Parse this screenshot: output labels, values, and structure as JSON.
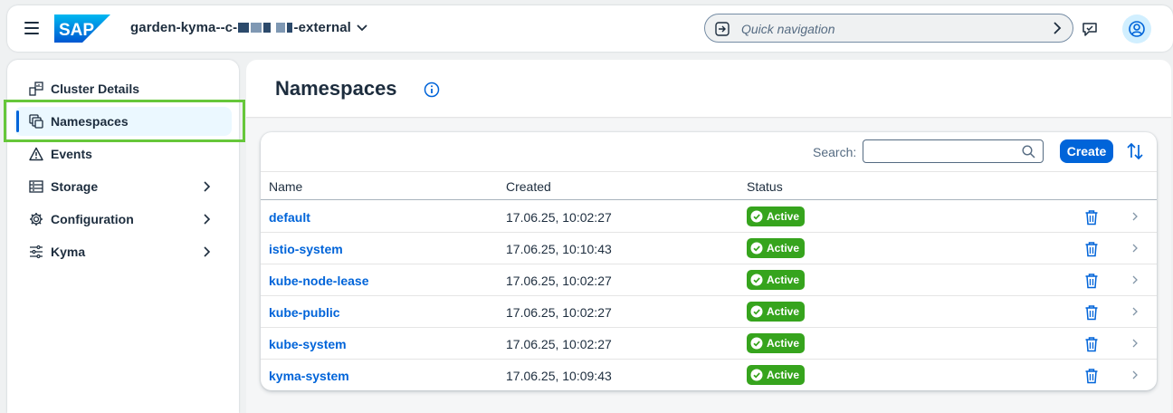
{
  "shell": {
    "cluster_name_prefix": "garden-kyma--c-",
    "cluster_name_suffix": "-external",
    "quick_nav_placeholder": "Quick navigation"
  },
  "sidebar": {
    "items": [
      {
        "label": "Cluster Details",
        "icon": "cluster-details-icon"
      },
      {
        "label": "Namespaces",
        "icon": "namespaces-icon",
        "selected": true
      },
      {
        "label": "Events",
        "icon": "warning-icon"
      },
      {
        "label": "Storage",
        "icon": "storage-icon",
        "expandable": true
      },
      {
        "label": "Configuration",
        "icon": "gear-icon",
        "expandable": true
      },
      {
        "label": "Kyma",
        "icon": "kyma-icon",
        "expandable": true
      }
    ]
  },
  "page": {
    "title": "Namespaces"
  },
  "toolbar": {
    "search_label": "Search:",
    "search_value": "",
    "create_label": "Create"
  },
  "table": {
    "columns": [
      "Name",
      "Created",
      "Status"
    ],
    "rows": [
      {
        "name": "default",
        "created": "17.06.25, 10:02:27",
        "status": "Active"
      },
      {
        "name": "istio-system",
        "created": "17.06.25, 10:10:43",
        "status": "Active"
      },
      {
        "name": "kube-node-lease",
        "created": "17.06.25, 10:02:27",
        "status": "Active"
      },
      {
        "name": "kube-public",
        "created": "17.06.25, 10:02:27",
        "status": "Active"
      },
      {
        "name": "kube-system",
        "created": "17.06.25, 10:02:27",
        "status": "Active"
      },
      {
        "name": "kyma-system",
        "created": "17.06.25, 10:09:43",
        "status": "Active"
      }
    ]
  },
  "colors": {
    "accent": "#0064d9",
    "status_active": "#36a41d",
    "highlight": "#66c73a"
  }
}
